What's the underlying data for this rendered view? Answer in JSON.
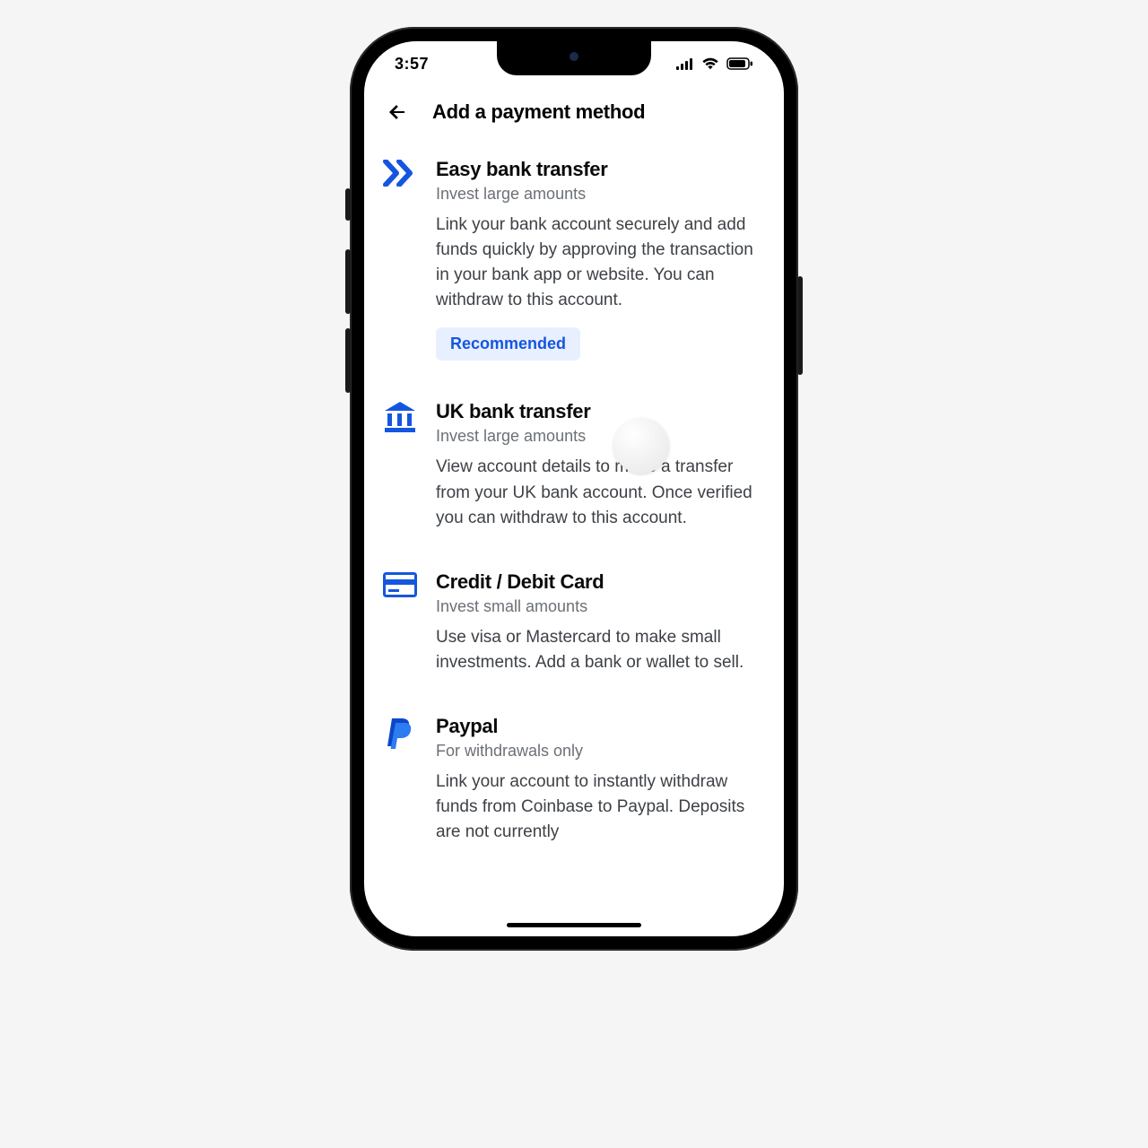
{
  "status": {
    "time": "3:57"
  },
  "header": {
    "title": "Add a payment method"
  },
  "methods": [
    {
      "id": "easy-bank-transfer",
      "title": "Easy bank transfer",
      "subtitle": "Invest large amounts",
      "description": "Link your bank account securely and add funds quickly by approving the transaction in your bank app or website. You can withdraw to this account.",
      "badge": "Recommended"
    },
    {
      "id": "uk-bank-transfer",
      "title": "UK bank transfer",
      "subtitle": "Invest large amounts",
      "description": "View account details to make a transfer from your UK bank account. Once verified you can withdraw to this account."
    },
    {
      "id": "credit-debit-card",
      "title": "Credit / Debit Card",
      "subtitle": "Invest small amounts",
      "description": "Use visa or Mastercard to make small investments. Add a bank or wallet to sell."
    },
    {
      "id": "paypal",
      "title": "Paypal",
      "subtitle": "For withdrawals only",
      "description": "Link your account to instantly withdraw funds from Coinbase to Paypal. Deposits are not currently"
    }
  ],
  "colors": {
    "accent": "#1556e0"
  }
}
